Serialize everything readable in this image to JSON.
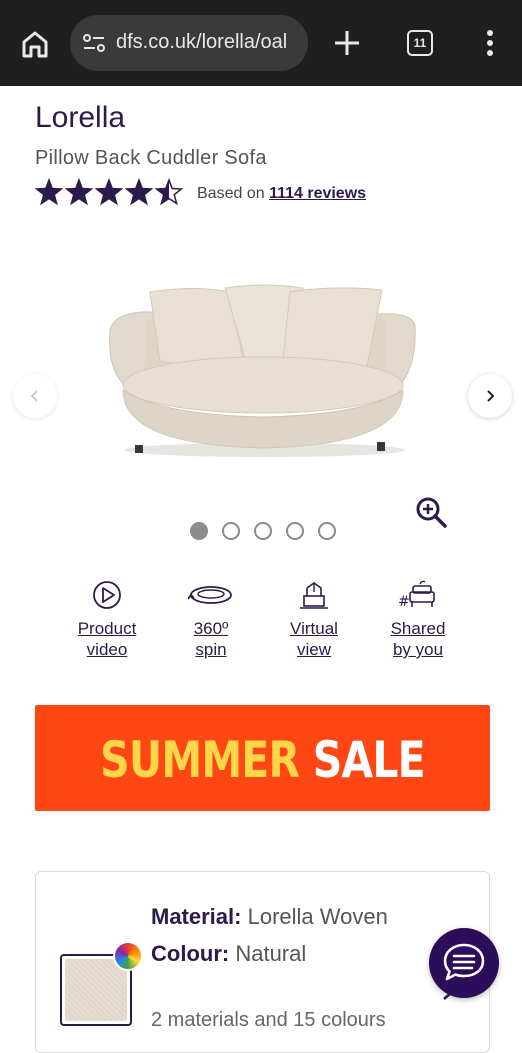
{
  "browser": {
    "url": "dfs.co.uk/lorella/oal",
    "tab_count": "11"
  },
  "product": {
    "name": "Lorella",
    "subtitle": "Pillow Back Cuddler Sofa",
    "rating": 4.5,
    "rating_max": 5,
    "reviews_prefix": "Based on",
    "reviews_link": "1114 reviews"
  },
  "gallery": {
    "image_count": 5,
    "active_index": 0
  },
  "features": [
    {
      "label": "Product\nvideo",
      "icon": "play-circle-icon"
    },
    {
      "label": "360º\nspin",
      "icon": "rotate-360-icon"
    },
    {
      "label": "Virtual\nview",
      "icon": "virtual-view-icon"
    },
    {
      "label": "Shared\nby you",
      "icon": "shared-sofa-icon"
    }
  ],
  "banner": {
    "word1": "SUMMER",
    "word2": "SALE",
    "colors": {
      "background": "#ff4714",
      "word1": "#ffd54a",
      "word2": "#ffffff"
    }
  },
  "options": {
    "material_label": "Material:",
    "material_value": "Lorella Woven",
    "colour_label": "Colour:",
    "colour_value": "Natural",
    "more_text": "2 materials and 15 colours"
  },
  "colors": {
    "brand_purple": "#2d1a4a",
    "chat_button": "#2d0d5a"
  }
}
